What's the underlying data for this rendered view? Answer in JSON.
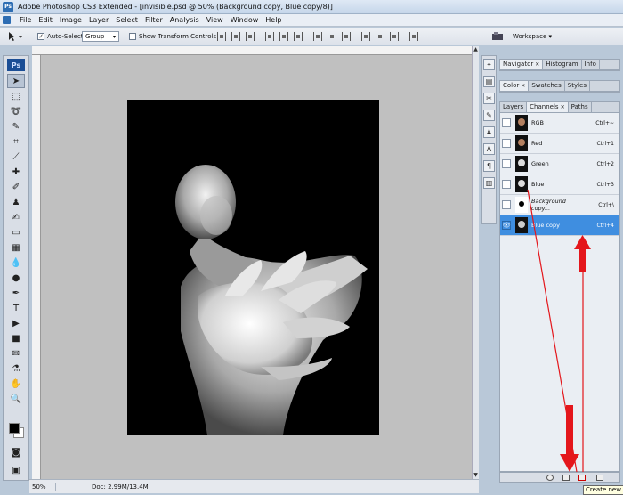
{
  "window": {
    "title": "Adobe Photoshop CS3 Extended - [invisible.psd @ 50% (Background copy, Blue copy/8)]"
  },
  "app_badge": "Ps",
  "menu": [
    "File",
    "Edit",
    "Image",
    "Layer",
    "Select",
    "Filter",
    "Analysis",
    "View",
    "Window",
    "Help"
  ],
  "options": {
    "auto_select_label": "Auto-Select:",
    "auto_select_checked": true,
    "auto_select_value": "Group",
    "show_transform_label": "Show Transform Controls",
    "show_transform_checked": false,
    "workspace_label": "Workspace ▾"
  },
  "panels": {
    "top_tabs": [
      "Navigator",
      "Histogram",
      "Info"
    ],
    "mid_tabs": [
      "Color",
      "Swatches",
      "Styles"
    ],
    "channel_tabs": [
      "Layers",
      "Channels",
      "Paths"
    ]
  },
  "channels": [
    {
      "name": "RGB",
      "shortcut": "Ctrl+~",
      "visible": false,
      "selected": false
    },
    {
      "name": "Red",
      "shortcut": "Ctrl+1",
      "visible": false,
      "selected": false
    },
    {
      "name": "Green",
      "shortcut": "Ctrl+2",
      "visible": false,
      "selected": false
    },
    {
      "name": "Blue",
      "shortcut": "Ctrl+3",
      "visible": false,
      "selected": false
    },
    {
      "name": "Background copy...",
      "shortcut": "Ctrl+\\",
      "visible": false,
      "selected": false
    },
    {
      "name": "Blue copy",
      "shortcut": "Ctrl+4",
      "visible": true,
      "selected": true
    }
  ],
  "status": {
    "zoom": "50%",
    "doc": "Doc: 2.99M/13.4M"
  },
  "tooltip": "Create new",
  "colors": {
    "selection_blue": "#3f8ee0",
    "arrow_red": "#e4161b",
    "foreground": "#000000",
    "background": "#ffffff"
  }
}
